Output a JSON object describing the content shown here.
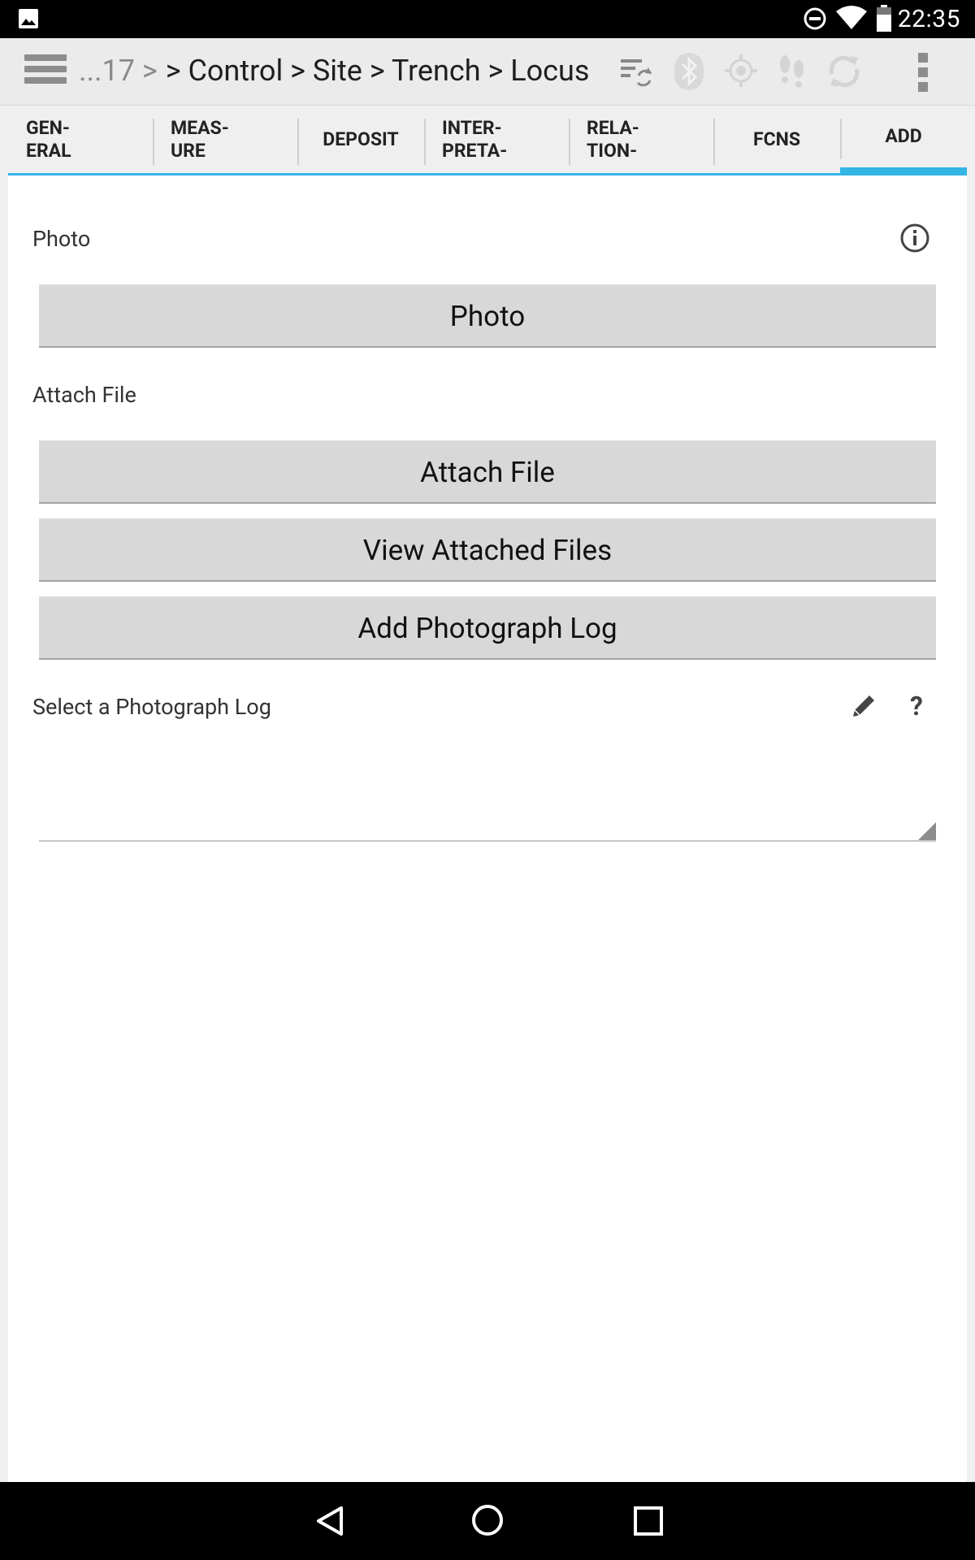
{
  "status_bar": {
    "time": "22:35"
  },
  "action_bar": {
    "breadcrumb_prefix": "...17 >",
    "breadcrumb_path": "> Control > Site > Trench > Locus"
  },
  "tabs": [
    {
      "label_line1": "GEN-",
      "label_line2": "ERAL"
    },
    {
      "label_line1": "MEAS-",
      "label_line2": "URE"
    },
    {
      "label": "DEPOSIT"
    },
    {
      "label_line1": "INTER-",
      "label_line2": "PRETA-"
    },
    {
      "label_line1": "RELA-",
      "label_line2": "TION-"
    },
    {
      "label": "FCNS"
    },
    {
      "label": "ADD"
    }
  ],
  "form": {
    "photo_label": "Photo",
    "photo_button": "Photo",
    "attach_label": "Attach File",
    "attach_button": "Attach File",
    "view_button": "View Attached Files",
    "add_log_button": "Add Photograph Log",
    "select_log_label": "Select a Photograph Log",
    "help_glyph": "?"
  },
  "colors": {
    "accent": "#33b5e5",
    "status_bar": "#000000",
    "button_bg": "#d8d8d8"
  },
  "icons": [
    "gallery-icon",
    "dnd-icon",
    "wifi-icon",
    "battery-icon",
    "menu-icon",
    "sync-list-icon",
    "bluetooth-icon",
    "gps-icon",
    "footsteps-icon",
    "refresh-icon",
    "overflow-icon",
    "info-icon",
    "pencil-icon",
    "back-icon",
    "home-icon",
    "recents-icon"
  ]
}
